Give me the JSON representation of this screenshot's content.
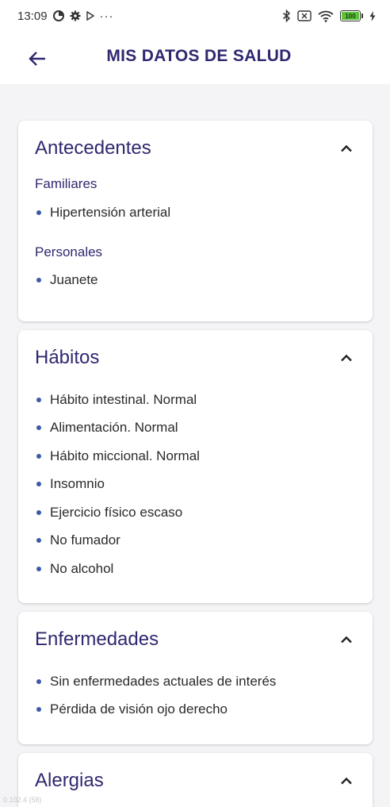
{
  "status_bar": {
    "time": "13:09",
    "battery": "100"
  },
  "header": {
    "title": "MIS DATOS DE SALUD"
  },
  "sections": {
    "antecedentes": {
      "title": "Antecedentes",
      "familiares": {
        "title": "Familiares",
        "items": [
          "Hipertensión arterial"
        ]
      },
      "personales": {
        "title": "Personales",
        "items": [
          "Juanete"
        ]
      }
    },
    "habitos": {
      "title": "Hábitos",
      "items": [
        "Hábito intestinal. Normal",
        "Alimentación. Normal",
        "Hábito miccional. Normal",
        "Insomnio",
        "Ejercicio físico escaso",
        "No fumador",
        "No alcohol"
      ]
    },
    "enfermedades": {
      "title": "Enfermedades",
      "items": [
        "Sin enfermedades actuales de interés",
        "Pérdida de visión ojo derecho"
      ]
    },
    "alergias": {
      "title": "Alergias"
    }
  },
  "footer_debug": "0.102.4 (58)",
  "colors": {
    "title": "#2f2870",
    "bullet": "#3a5aa8",
    "background": "#f4f4f6"
  }
}
